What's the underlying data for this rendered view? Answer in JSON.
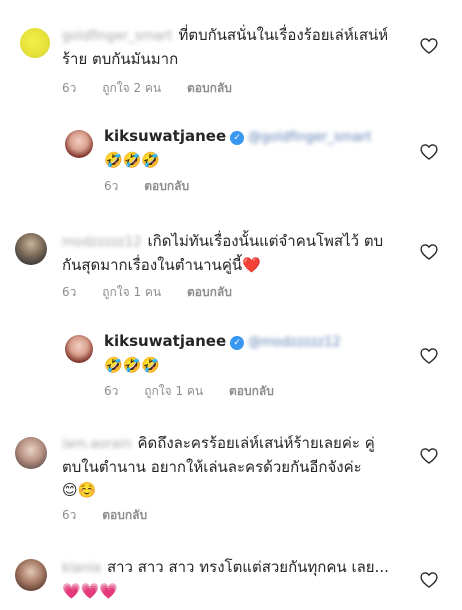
{
  "comments": [
    {
      "username": "goldfinger_smart",
      "text": "ที่ตบกันสนั่นในเรื่องร้อยเล่ห์เสน่ห์ร้าย ตบกันมันมาก",
      "emoji": "",
      "time": "6ว",
      "likes": "ถูกใจ 2 คน",
      "reply": "ตอบกลับ"
    },
    {
      "username": "kiksuwatjanee",
      "verified_icon": "verified-badge-icon",
      "mention": "@goldfinger_smart",
      "text": "",
      "emoji": "🤣🤣🤣",
      "time": "6ว",
      "likes": "",
      "reply": "ตอบกลับ"
    },
    {
      "username": "modzzzzz12",
      "text": "เกิดไม่ทันเรื่องนั้นแต่จำคนโพสไว้ ตบกันสุดมากเรื่องในตำนานคู่นี้",
      "emoji": "❤️",
      "time": "6ว",
      "likes": "ถูกใจ 1 คน",
      "reply": "ตอบกลับ"
    },
    {
      "username": "kiksuwatjanee",
      "verified_icon": "verified-badge-icon",
      "mention": "@modzzzzz12",
      "text": "",
      "emoji": "🤣🤣🤣",
      "time": "6ว",
      "likes": "ถูกใจ 1 คน",
      "reply": "ตอบกลับ"
    },
    {
      "username": "lam.aorain",
      "text": "คิดถึงละครร้อยเล่ห์เสน่ห์ร้ายเลยค่ะ คู่ตบในตำนาน อยากให้เล่นละครด้วยกันอีกจังค่ะ",
      "emoji": "😊☺️",
      "time": "6ว",
      "likes": "",
      "reply": "ตอบกลับ"
    },
    {
      "username": "klanla",
      "text": "สาว สาว สาว ทรงโตแต่สวยกันทุกคน เลย...",
      "emoji": "💗💗💗",
      "time": "",
      "likes": "",
      "reply": ""
    }
  ],
  "icons": {
    "like": "heart-outline-icon",
    "verified": "verified-badge-icon"
  },
  "colors": {
    "meta": "#8e8e8e",
    "verified": "#3897f0",
    "heart_stroke": "#262626"
  }
}
